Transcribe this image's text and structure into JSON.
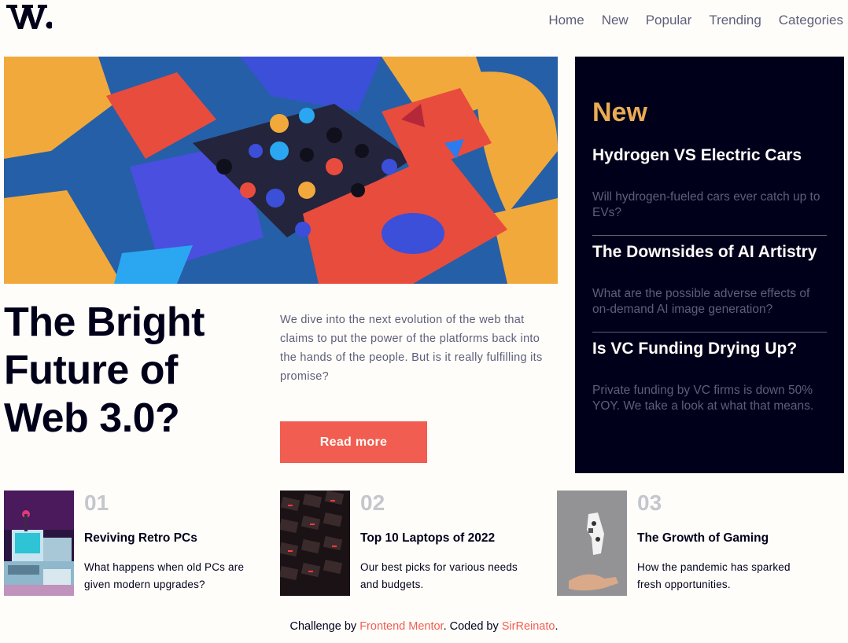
{
  "brand": {
    "logo_text": "W."
  },
  "nav": {
    "items": [
      "Home",
      "New",
      "Popular",
      "Trending",
      "Categories"
    ]
  },
  "hero": {
    "headline": "The Bright Future of Web 3.0?",
    "description": "We dive into the next evolution of the web that claims to put the power of the platforms back into the hands of the people. But is it really fulfilling its promise?",
    "button_label": "Read more"
  },
  "new_panel": {
    "title": "New",
    "items": [
      {
        "title": "Hydrogen VS Electric Cars",
        "excerpt": "Will hydrogen-fueled cars ever catch up to EVs?"
      },
      {
        "title": "The Downsides of AI Artistry",
        "excerpt": "What are the possible adverse effects of on-demand AI image generation?"
      },
      {
        "title": "Is VC Funding Drying Up?",
        "excerpt": "Private funding by VC firms is down 50% YOY. We take a look at what that means."
      }
    ]
  },
  "articles": [
    {
      "number": "01",
      "title": "Reviving Retro PCs",
      "excerpt": "What happens when old PCs are given modern upgrades?"
    },
    {
      "number": "02",
      "title": "Top 10 Laptops of 2022",
      "excerpt": "Our best picks for various needs and budgets."
    },
    {
      "number": "03",
      "title": "The Growth of Gaming",
      "excerpt": "How the pandemic has sparked fresh opportunities."
    }
  ],
  "footer": {
    "prefix": "Challenge by",
    "challenge_link": "Frontend Mentor",
    "middle": ". Coded by",
    "author_link": "SirReinato",
    "suffix": "."
  },
  "colors": {
    "accent_red": "#f15d51",
    "accent_orange": "#e9ab53",
    "dark_navy": "#00001a",
    "grayish_blue": "#5d5f79",
    "off_white": "#fffdfa"
  }
}
